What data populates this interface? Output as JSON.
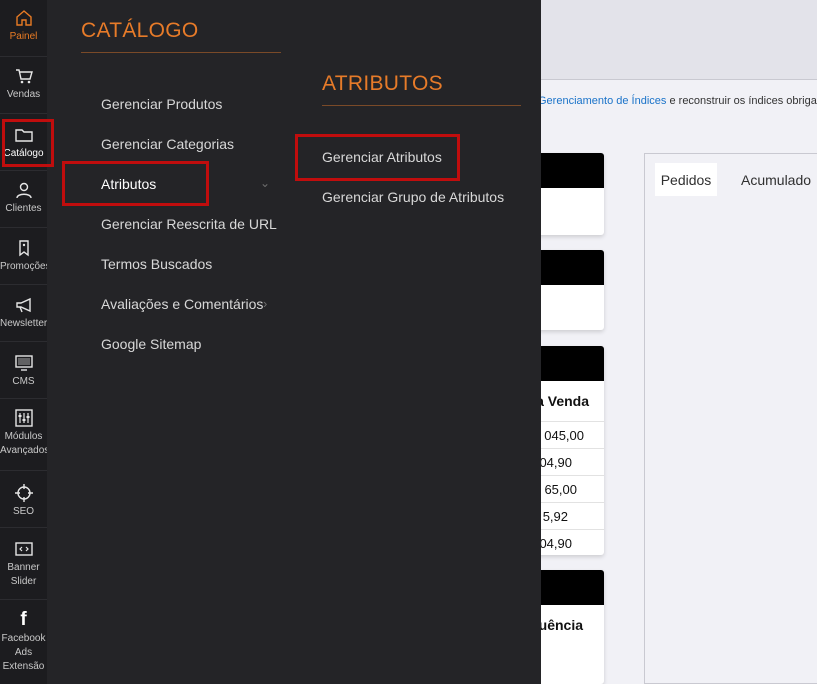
{
  "nav": {
    "items": [
      {
        "label": "Painel",
        "icon": "home-icon"
      },
      {
        "label": "Vendas",
        "icon": "cart-icon"
      },
      {
        "label": "Catálogo",
        "icon": "folder-icon"
      },
      {
        "label": "Clientes",
        "icon": "user-icon"
      },
      {
        "label": "Promoções",
        "icon": "tag-icon"
      },
      {
        "label": "Newsletter",
        "icon": "megaphone-icon"
      },
      {
        "label": "CMS",
        "icon": "monitor-icon"
      },
      {
        "label": "Módulos Avançados",
        "icon": "sliders-icon"
      },
      {
        "label": "SEO",
        "icon": "crosshair-icon"
      },
      {
        "label": "Banner Slider",
        "icon": "code-box-icon"
      },
      {
        "label": "Facebook Ads Extensão",
        "icon": "facebook-icon"
      }
    ],
    "accent": "#e87b24"
  },
  "catalog_menu": {
    "title": "CATÁLOGO",
    "items": [
      {
        "label": "Gerenciar Produtos"
      },
      {
        "label": "Gerenciar Categorias"
      },
      {
        "label": "Atributos"
      },
      {
        "label": "Gerenciar Reescrita de URL"
      },
      {
        "label": "Termos Buscados"
      },
      {
        "label": "Avaliações e Comentários"
      },
      {
        "label": "Google Sitemap"
      }
    ]
  },
  "attributes_menu": {
    "title": "ATRIBUTOS",
    "items": [
      {
        "label": "Gerenciar Atributos"
      },
      {
        "label": "Gerenciar Grupo de Atributos"
      }
    ]
  },
  "background": {
    "notice_link": "Gerenciamento de Índices",
    "notice_text": " e reconstruir os índices obrigató",
    "card_col_1": "a Venda",
    "card_values": [
      "045,00",
      "04,90",
      "65,00",
      "5,92",
      "04,90"
    ],
    "card_col_2": "uência",
    "tabs": [
      {
        "label": "Pedidos"
      },
      {
        "label": "Acumulado"
      }
    ]
  },
  "colors": {
    "highlight": "#c00d0d",
    "menu_bg": "#242427",
    "title_orange": "#e77b29"
  }
}
